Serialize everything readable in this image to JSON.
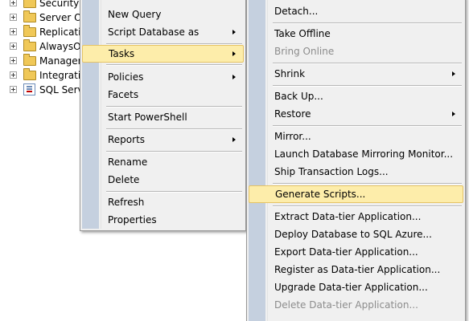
{
  "tree": {
    "items": [
      {
        "label": "Security",
        "icon": "folder-icon"
      },
      {
        "label": "Server Ob",
        "icon": "folder-icon"
      },
      {
        "label": "Replicatio",
        "icon": "folder-icon"
      },
      {
        "label": "AlwaysOr",
        "icon": "folder-icon"
      },
      {
        "label": "Managem",
        "icon": "folder-icon"
      },
      {
        "label": "Integratio",
        "icon": "folder-icon"
      },
      {
        "label": "SQL Serve",
        "icon": "sql-agent-icon"
      }
    ]
  },
  "context_menu": {
    "items": [
      {
        "label": "New Query"
      },
      {
        "label": "Script Database as",
        "has_submenu": true
      },
      {
        "label": "Tasks",
        "has_submenu": true,
        "highlighted": true
      },
      {
        "label": "Policies",
        "has_submenu": true
      },
      {
        "label": "Facets"
      },
      {
        "label": "Start PowerShell"
      },
      {
        "label": "Reports",
        "has_submenu": true
      },
      {
        "label": "Rename"
      },
      {
        "label": "Delete"
      },
      {
        "label": "Refresh"
      },
      {
        "label": "Properties"
      }
    ]
  },
  "tasks_submenu": {
    "items": [
      {
        "label": "Detach..."
      },
      {
        "label": "Take Offline"
      },
      {
        "label": "Bring Online",
        "disabled": true
      },
      {
        "label": "Shrink",
        "has_submenu": true
      },
      {
        "label": "Back Up..."
      },
      {
        "label": "Restore",
        "has_submenu": true
      },
      {
        "label": "Mirror..."
      },
      {
        "label": "Launch Database Mirroring Monitor..."
      },
      {
        "label": "Ship Transaction Logs..."
      },
      {
        "label": "Generate Scripts...",
        "highlighted": true
      },
      {
        "label": "Extract Data-tier Application..."
      },
      {
        "label": "Deploy Database to SQL Azure..."
      },
      {
        "label": "Export Data-tier Application..."
      },
      {
        "label": "Register as Data-tier Application..."
      },
      {
        "label": "Upgrade Data-tier Application..."
      },
      {
        "label": "Delete Data-tier Application...",
        "disabled": true
      }
    ]
  },
  "colors": {
    "menu_background": "#f0f0f0",
    "menu_gutter": "#c5d0df",
    "highlight_background": "#fdedaa",
    "highlight_border": "#e5c365",
    "disabled_text": "#8c8c8c"
  }
}
